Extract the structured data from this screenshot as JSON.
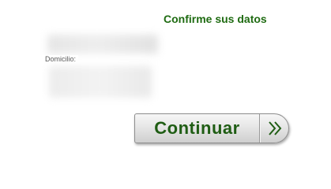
{
  "form": {
    "heading": "Confirme sus datos",
    "address_label": "Domicilio:"
  },
  "actions": {
    "continue_label": "Continuar",
    "continue_icon": "double-chevron-right-icon"
  },
  "colors": {
    "heading_text": "#1f6b12",
    "button_text": "#1f5d14",
    "button_background": "#e2e2e2",
    "button_border": "#8e8e8e"
  }
}
